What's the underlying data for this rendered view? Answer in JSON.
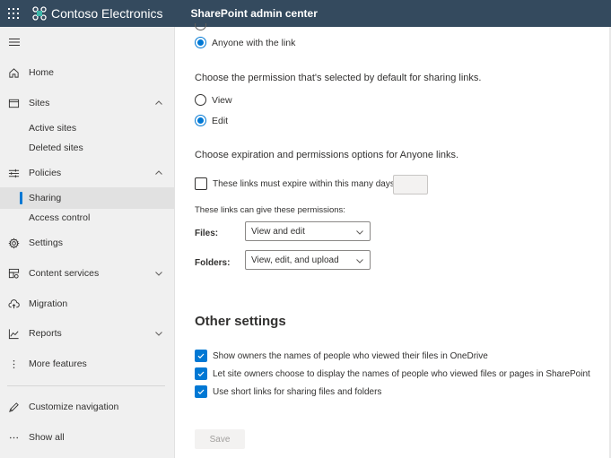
{
  "header": {
    "brand_name": "Contoso Electronics",
    "app_title": "SharePoint admin center",
    "brand_color": "#344a5e",
    "logo_color": "#3bb6a8"
  },
  "sidebar": {
    "items": [
      {
        "label": "Home",
        "icon": "home-icon"
      },
      {
        "label": "Sites",
        "icon": "browser-window-icon",
        "expanded": true
      },
      {
        "label": "Active sites",
        "sub": true
      },
      {
        "label": "Deleted sites",
        "sub": true
      },
      {
        "label": "Policies",
        "icon": "sliders-icon",
        "expanded": true
      },
      {
        "label": "Sharing",
        "sub": true,
        "selected": true
      },
      {
        "label": "Access control",
        "sub": true
      },
      {
        "label": "Settings",
        "icon": "gear-icon"
      },
      {
        "label": "Content services",
        "icon": "content-services-icon",
        "expanded": false
      },
      {
        "label": "Migration",
        "icon": "cloud-upload-icon"
      },
      {
        "label": "Reports",
        "icon": "chart-line-icon",
        "expanded": false
      },
      {
        "label": "More features",
        "icon": "more-vertical-icon"
      },
      {
        "label": "Customize navigation",
        "icon": "pencil-icon"
      },
      {
        "label": "Show all",
        "icon": "more-horizontal-icon"
      }
    ]
  },
  "main": {
    "link_type_option": {
      "label": "Anyone with the link",
      "checked": true
    },
    "default_permission": {
      "heading": "Choose the permission that's selected by default for sharing links.",
      "options": [
        {
          "label": "View",
          "checked": false
        },
        {
          "label": "Edit",
          "checked": true
        }
      ]
    },
    "anyone_links": {
      "heading": "Choose expiration and permissions options for Anyone links.",
      "expire_checkbox": {
        "label": "These links must expire within this many days",
        "checked": false
      },
      "expire_days_value": "",
      "permissions_label": "These links can give these permissions:",
      "files": {
        "label": "Files:",
        "value": "View and edit"
      },
      "folders": {
        "label": "Folders:",
        "value": "View, edit, and upload"
      }
    },
    "other_settings": {
      "heading": "Other settings",
      "options": [
        {
          "label": "Show owners the names of people who viewed their files in OneDrive",
          "checked": true
        },
        {
          "label": "Let site owners choose to display the names of people who viewed files or pages in SharePoint",
          "checked": true
        },
        {
          "label": "Use short links for sharing files and folders",
          "checked": true
        }
      ]
    },
    "save_label": "Save",
    "accent_color": "#0078d4"
  }
}
